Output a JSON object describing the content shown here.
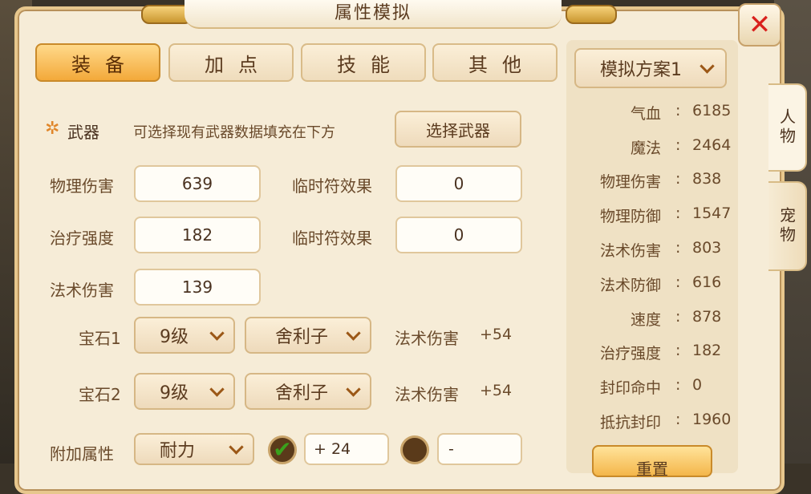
{
  "window": {
    "title": "属性模拟",
    "close_label": "✕"
  },
  "tabs": [
    {
      "label": "装备",
      "active": true
    },
    {
      "label": "加点",
      "active": false
    },
    {
      "label": "技能",
      "active": false
    },
    {
      "label": "其他",
      "active": false
    }
  ],
  "weapon": {
    "star": "✲",
    "label": "武器",
    "hint": "可选择现有武器数据填充在下方",
    "select_button": "选择武器"
  },
  "attributes": [
    {
      "label": "物理伤害",
      "value": "639"
    },
    {
      "label": "治疗强度",
      "value": "182"
    },
    {
      "label": "法术伤害",
      "value": "139"
    }
  ],
  "temp_effects": [
    {
      "label": "临时符效果",
      "value": "0"
    },
    {
      "label": "临时符效果",
      "value": "0"
    }
  ],
  "gems": [
    {
      "label": "宝石1",
      "level": "9级",
      "type": "舍利子",
      "effect": "法术伤害",
      "bonus": "+54"
    },
    {
      "label": "宝石2",
      "level": "9级",
      "type": "舍利子",
      "effect": "法术伤害",
      "bonus": "+54"
    }
  ],
  "extra": {
    "label": "附加属性",
    "attr": "耐力",
    "value1": "+ 24",
    "value2": "-",
    "check1": "✔"
  },
  "scheme": {
    "selected": "模拟方案1"
  },
  "stats": [
    {
      "name": "气血",
      "value": "6185"
    },
    {
      "name": "魔法",
      "value": "2464"
    },
    {
      "name": "物理伤害",
      "value": "838"
    },
    {
      "name": "物理防御",
      "value": "1547"
    },
    {
      "name": "法术伤害",
      "value": "803"
    },
    {
      "name": "法术防御",
      "value": "616"
    },
    {
      "name": "速度",
      "value": "878"
    },
    {
      "name": "治疗强度",
      "value": "182"
    },
    {
      "name": "封印命中",
      "value": "0"
    },
    {
      "name": "抵抗封印",
      "value": "1960"
    }
  ],
  "stat_separator": ":",
  "reset_button": "重置",
  "side_tabs": [
    {
      "label": "人物",
      "active": true
    },
    {
      "label": "宠物",
      "active": false
    }
  ],
  "colors": {
    "accent": "#f3a93a",
    "check_green": "#3aa11c",
    "text_brown": "#5b3b1f"
  }
}
